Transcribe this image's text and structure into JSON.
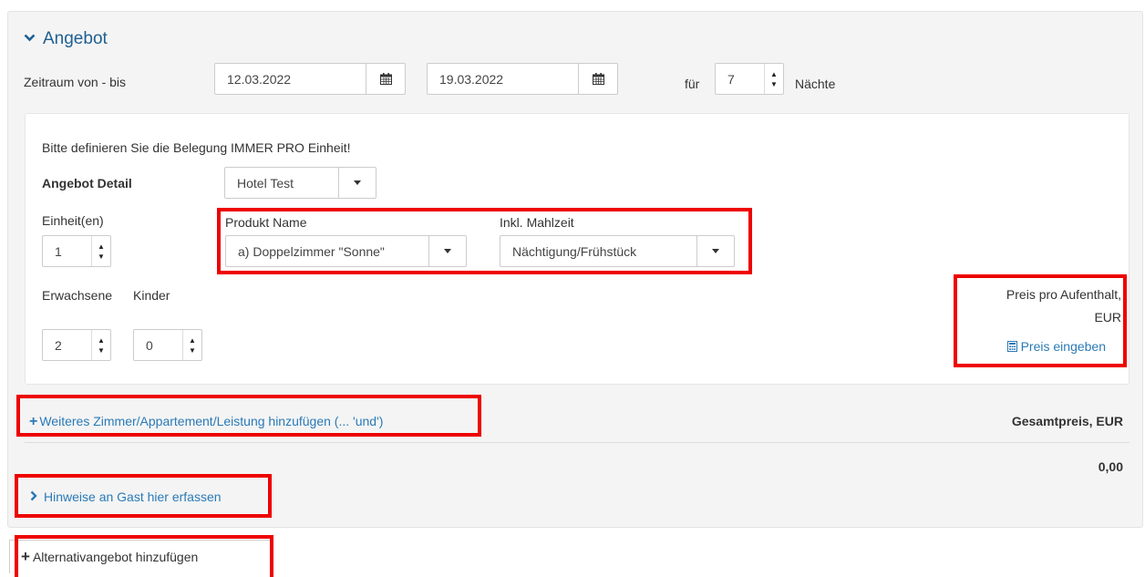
{
  "section": {
    "title": "Angebot"
  },
  "period": {
    "label": "Zeitraum von - bis",
    "from": "12.03.2022",
    "to": "19.03.2022",
    "for_label": "für",
    "nights": "7",
    "nights_label": "Nächte"
  },
  "detail": {
    "note": "Bitte definieren Sie die Belegung IMMER PRO Einheit!",
    "label": "Angebot Detail",
    "hotel": "Hotel Test",
    "units_label": "Einheit(en)",
    "units": "1",
    "product_label": "Produkt Name",
    "product": "a) Doppelzimmer \"Sonne\"",
    "meal_label": "Inkl. Mahlzeit",
    "meal": "Nächtigung/Frühstück",
    "adults_label": "Erwachsene",
    "children_label": "Kinder",
    "adults": "2",
    "children": "0",
    "price_label_1": "Preis pro Aufenthalt,",
    "price_label_2": "EUR",
    "price_link": "Preis eingeben"
  },
  "add_room_link": "Weiteres Zimmer/Appartement/Leistung hinzufügen (... 'und')",
  "total": {
    "label": "Gesamtpreis, EUR",
    "value": "0,00"
  },
  "notes_link": "Hinweise an Gast hier erfassen",
  "alt_offer_button": "Alternativangebot hinzufügen",
  "icons": {
    "section_toggle": "chevron-down-icon",
    "date_picker": "calendar-icon",
    "price": "calculator-icon",
    "add": "plus-icon",
    "notes_toggle": "chevron-right-icon"
  },
  "colors": {
    "accent": "#1f5f91",
    "link": "#2a7ab7",
    "highlight": "#ee0000"
  }
}
